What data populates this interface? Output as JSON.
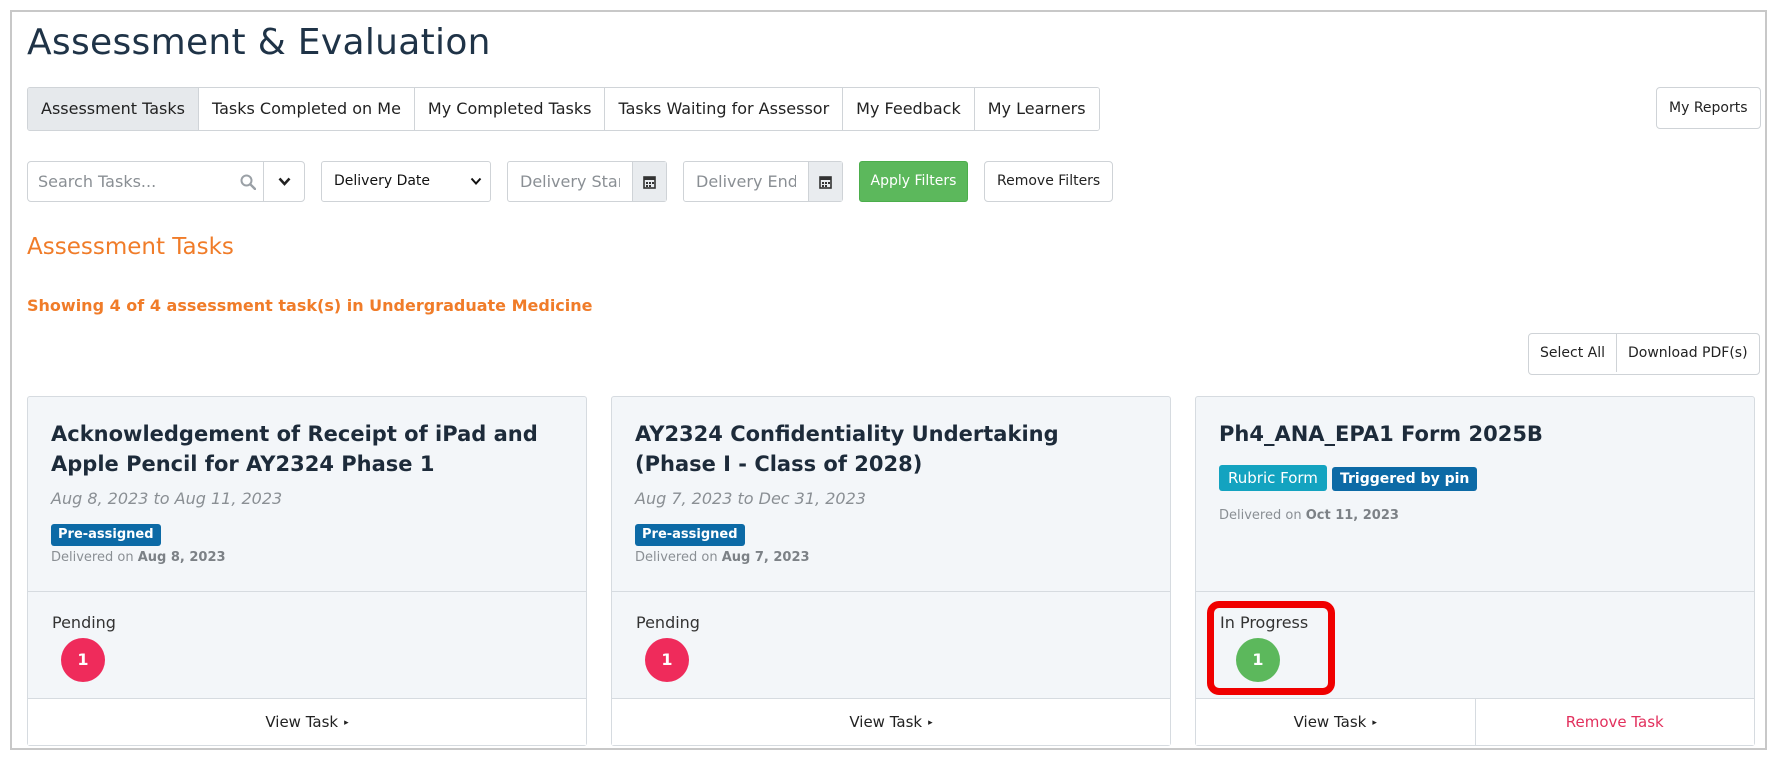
{
  "page": {
    "title": "Assessment & Evaluation"
  },
  "tabs": [
    {
      "label": "Assessment Tasks",
      "active": true
    },
    {
      "label": "Tasks Completed on Me"
    },
    {
      "label": "My Completed Tasks"
    },
    {
      "label": "Tasks Waiting for Assessor"
    },
    {
      "label": "My Feedback"
    },
    {
      "label": "My Learners"
    }
  ],
  "my_reports_label": "My Reports",
  "filters": {
    "search_placeholder": "Search Tasks...",
    "date_select_value": "Delivery Date",
    "start_placeholder": "Delivery Start",
    "end_placeholder": "Delivery End",
    "apply_label": "Apply Filters",
    "remove_label": "Remove Filters"
  },
  "section": {
    "title": "Assessment Tasks",
    "showing": "Showing 4 of 4 assessment task(s) in Undergraduate Medicine"
  },
  "actions": {
    "select_all": "Select All",
    "download": "Download PDF(s)"
  },
  "cards": [
    {
      "title": "Acknowledgement of Receipt of iPad and Apple Pencil for AY2324 Phase 1",
      "dates": "Aug 8, 2023 to Aug 11, 2023",
      "badge": "Pre-assigned",
      "delivered_prefix": "Delivered on",
      "delivered_date": "Aug 8, 2023",
      "status": "Pending",
      "count": "1",
      "view_label": "View Task"
    },
    {
      "title": "AY2324 Confidentiality Undertaking (Phase I - Class of 2028)",
      "dates": "Aug 7, 2023 to Dec 31, 2023",
      "badge": "Pre-assigned",
      "delivered_prefix": "Delivered on",
      "delivered_date": "Aug 7, 2023",
      "status": "Pending",
      "count": "1",
      "view_label": "View Task"
    },
    {
      "title": "Ph4_ANA_EPA1 Form 2025B",
      "badges": [
        "Rubric Form",
        "Triggered by pin"
      ],
      "delivered_prefix": "Delivered on",
      "delivered_date": "Oct 11, 2023",
      "status": "In Progress",
      "count": "1",
      "view_label": "View Task",
      "remove_label": "Remove Task"
    }
  ],
  "colors": {
    "accent_orange": "#f07c29",
    "badge_blue": "#0c6aa6",
    "badge_teal": "#13a3c0",
    "pending_red": "#ef2b5b",
    "progress_green": "#5cb85c",
    "danger": "#e2305d",
    "highlight": "#f00000"
  }
}
